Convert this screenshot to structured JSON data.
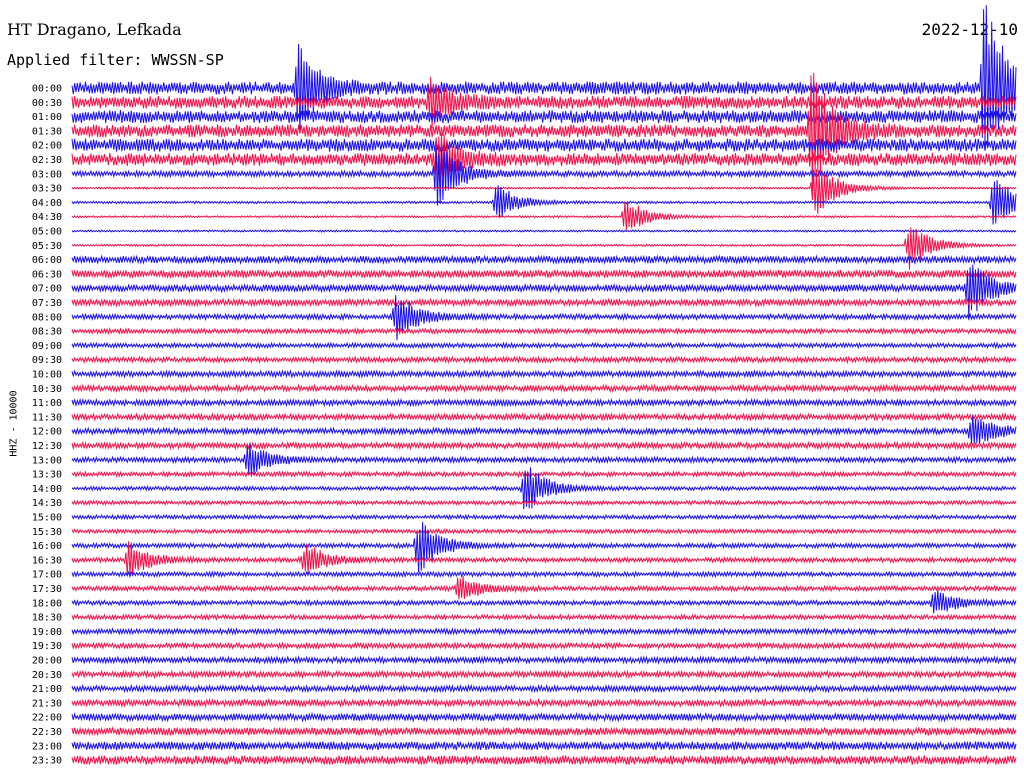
{
  "header": {
    "station": "HT Dragano, Lefkada",
    "date": "2022-12-10",
    "filter": "Applied filter: WWSSN-SP"
  },
  "colors": {
    "trace_a": "#1a0fe6",
    "trace_b": "#f0104a",
    "background": "#ffffff",
    "text": "#000000"
  },
  "chart_data": {
    "type": "line",
    "ylabel": "HHZ - 10000",
    "row_labels": [
      "00:00",
      "00:30",
      "01:00",
      "01:30",
      "02:00",
      "02:30",
      "03:00",
      "03:30",
      "04:00",
      "04:30",
      "05:00",
      "05:30",
      "06:00",
      "06:30",
      "07:00",
      "07:30",
      "08:00",
      "08:30",
      "09:00",
      "09:30",
      "10:00",
      "10:30",
      "11:00",
      "11:30",
      "12:00",
      "12:30",
      "13:00",
      "13:30",
      "14:00",
      "14:30",
      "15:00",
      "15:30",
      "16:00",
      "16:30",
      "17:00",
      "17:30",
      "18:00",
      "18:30",
      "19:00",
      "19:30",
      "20:00",
      "20:30",
      "21:00",
      "21:30",
      "22:00",
      "22:30",
      "23:00",
      "23:30"
    ],
    "colors": [
      "#1a0fe6",
      "#f0104a"
    ],
    "minutes_per_line": 30,
    "noise_level": [
      1.0,
      1.0,
      1.0,
      1.0,
      1.0,
      1.0,
      0.45,
      0.15,
      0.18,
      0.15,
      0.15,
      0.15,
      0.55,
      0.6,
      0.55,
      0.5,
      0.4,
      0.35,
      0.35,
      0.4,
      0.45,
      0.45,
      0.45,
      0.45,
      0.45,
      0.45,
      0.4,
      0.35,
      0.3,
      0.3,
      0.3,
      0.3,
      0.35,
      0.35,
      0.35,
      0.35,
      0.35,
      0.35,
      0.4,
      0.4,
      0.45,
      0.45,
      0.45,
      0.5,
      0.55,
      0.6,
      0.65,
      0.7
    ],
    "events": [
      {
        "line": 0,
        "minute": 7.2,
        "amp": 2.2
      },
      {
        "line": 1,
        "minute": 11.4,
        "amp": 1.2
      },
      {
        "line": 5,
        "minute": 11.6,
        "amp": 1.5
      },
      {
        "line": 6,
        "minute": 11.6,
        "amp": 1.8
      },
      {
        "line": 8,
        "minute": 13.5,
        "amp": 1.0
      },
      {
        "line": 3,
        "minute": 23.5,
        "amp": 3.5
      },
      {
        "line": 0,
        "minute": 29.0,
        "amp": 5.0
      },
      {
        "line": 7,
        "minute": 23.6,
        "amp": 1.6
      },
      {
        "line": 9,
        "minute": 17.6,
        "amp": 1.0
      },
      {
        "line": 11,
        "minute": 26.6,
        "amp": 1.4
      },
      {
        "line": 8,
        "minute": 29.3,
        "amp": 1.5
      },
      {
        "line": 14,
        "minute": 28.5,
        "amp": 1.6
      },
      {
        "line": 16,
        "minute": 10.3,
        "amp": 1.2
      },
      {
        "line": 24,
        "minute": 28.6,
        "amp": 1.0
      },
      {
        "line": 26,
        "minute": 5.6,
        "amp": 0.9
      },
      {
        "line": 28,
        "minute": 14.4,
        "amp": 1.4
      },
      {
        "line": 32,
        "minute": 11.0,
        "amp": 1.5
      },
      {
        "line": 33,
        "minute": 1.8,
        "amp": 1.0
      },
      {
        "line": 33,
        "minute": 7.4,
        "amp": 0.9
      },
      {
        "line": 35,
        "minute": 12.3,
        "amp": 0.7
      },
      {
        "line": 36,
        "minute": 27.4,
        "amp": 0.7
      }
    ]
  }
}
